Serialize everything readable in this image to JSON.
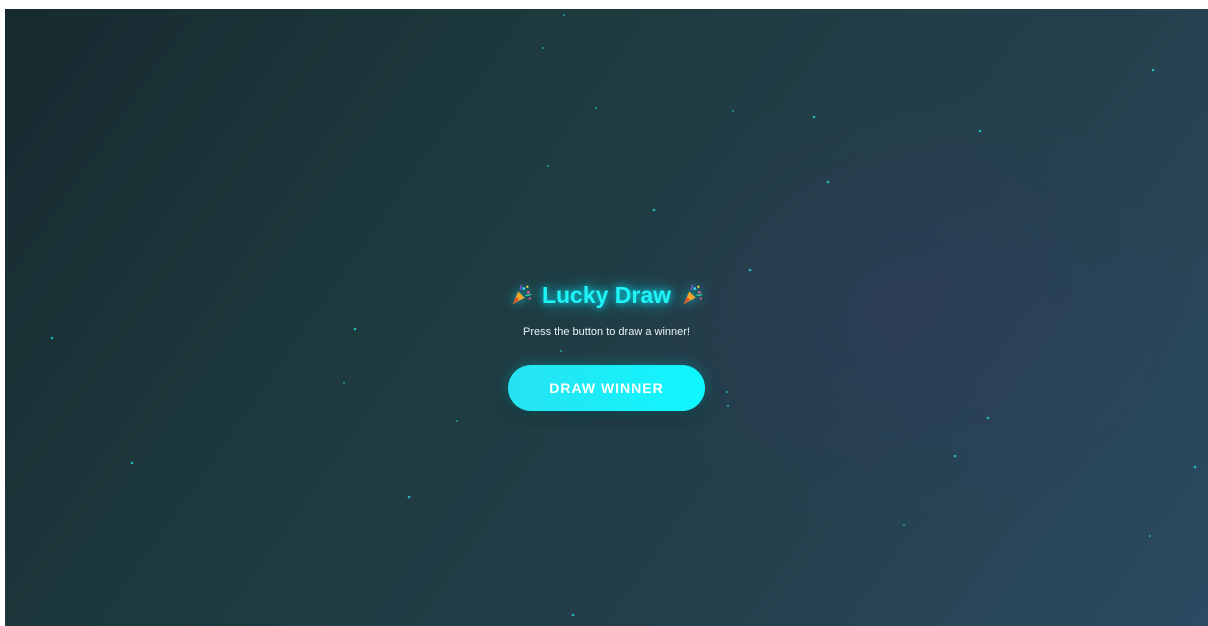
{
  "app": {
    "title": "Lucky Draw",
    "subtitle": "Press the button to draw a winner!",
    "button_label": "DRAW WINNER",
    "icon_left": "party-popper-icon",
    "icon_right": "party-popper-icon"
  },
  "colors": {
    "accent": "#1ff4f6",
    "background_dark": "#172a30",
    "background_light": "#2b4b62",
    "star": "#28d4d8"
  }
}
